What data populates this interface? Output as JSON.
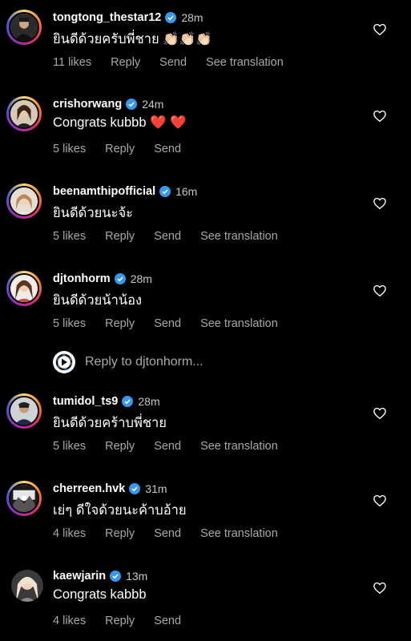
{
  "comments": [
    {
      "username": "tongtong_thestar12",
      "time": "28m",
      "text": "ยินดีด้วยครับพี่ชาย 👏🏻👏🏻👏🏻",
      "likes": "11 likes",
      "reply": "Reply",
      "send": "Send",
      "translation": "See translation"
    },
    {
      "username": "crishorwang",
      "time": "24m",
      "text": "Congrats kubbb ❤️ ❤️",
      "likes": "5 likes",
      "reply": "Reply",
      "send": "Send",
      "translation": ""
    },
    {
      "username": "beenamthipofficial",
      "time": "16m",
      "text": "ยินดีด้วยนะจ้ะ",
      "likes": "5 likes",
      "reply": "Reply",
      "send": "Send",
      "translation": "See translation"
    },
    {
      "username": "djtonhorm",
      "time": "28m",
      "text": "ยินดีด้วยน้าน้อง",
      "likes": "5 likes",
      "reply": "Reply",
      "send": "Send",
      "translation": "See translation"
    },
    {
      "username": "tumidol_ts9",
      "time": "28m",
      "text": "ยินดีด้วยคร้าบพี่ชาย",
      "likes": "5 likes",
      "reply": "Reply",
      "send": "Send",
      "translation": "See translation"
    },
    {
      "username": "cherreen.hvk",
      "time": "31m",
      "text": "เย่ๆ ดีใจด้วยนะค้าบอ้าย",
      "likes": "4 likes",
      "reply": "Reply",
      "send": "Send",
      "translation": "See translation"
    },
    {
      "username": "kaewjarin",
      "time": "13m",
      "text": "Congrats kabbb",
      "likes": "4 likes",
      "reply": "Reply",
      "send": "Send",
      "translation": ""
    }
  ],
  "reply_prompt": {
    "text": "Reply to djtonhorm..."
  },
  "icons": {
    "like": "heart-outline-icon",
    "verified": "verified-badge-icon"
  },
  "colors": {
    "background": "#000000",
    "verified": "#3897f0",
    "secondary_text": "#a8a8a8"
  }
}
